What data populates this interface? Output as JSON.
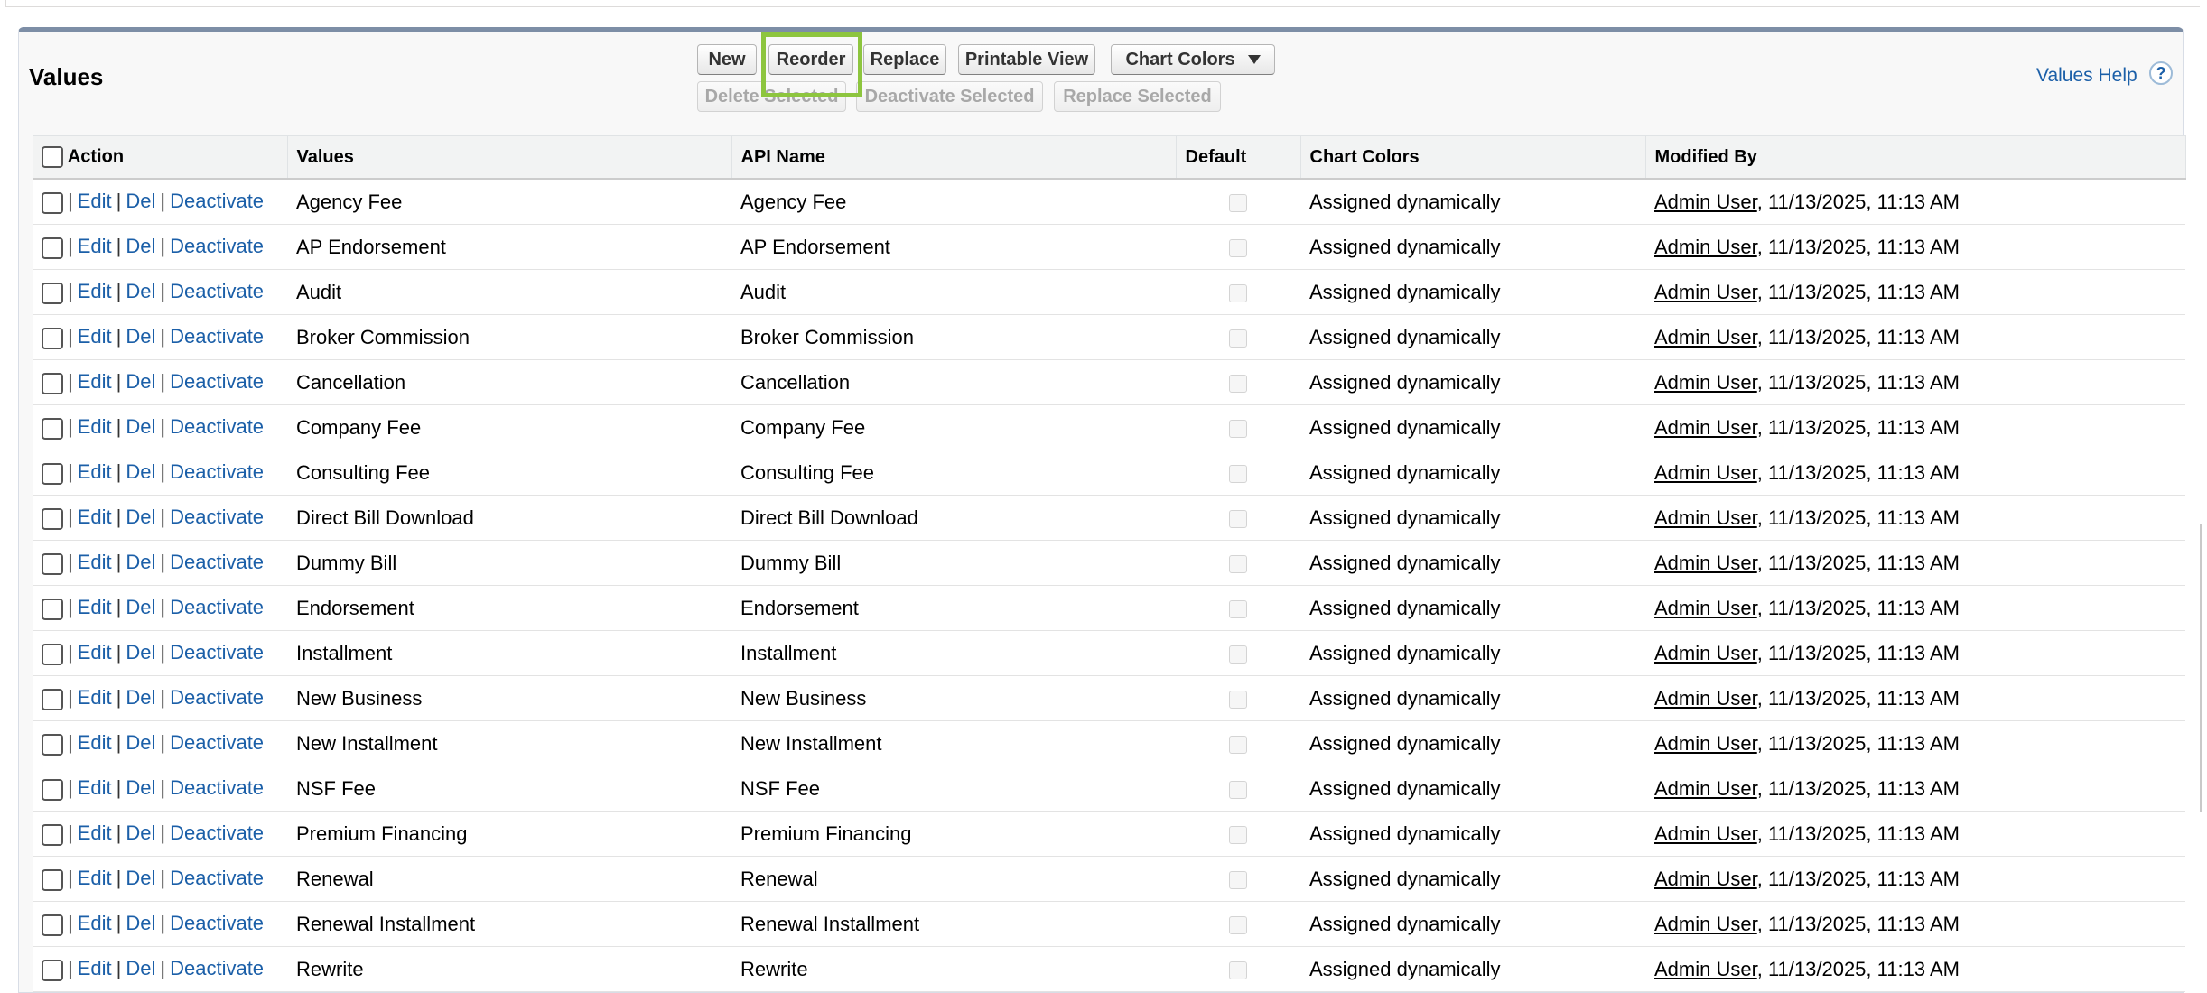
{
  "section": {
    "title": "Values",
    "help_label": "Values Help",
    "help_icon": "?"
  },
  "toolbar": {
    "new_label": "New",
    "reorder_label": "Reorder",
    "replace_label": "Replace",
    "printable_view_label": "Printable View",
    "chart_colors_label": "Chart Colors",
    "delete_selected_label": "Delete Selected",
    "deactivate_selected_label": "Deactivate Selected",
    "replace_selected_label": "Replace Selected"
  },
  "highlight_color": "#8dc53e",
  "table": {
    "headers": {
      "action": "Action",
      "values": "Values",
      "api_name": "API Name",
      "default": "Default",
      "chart_colors": "Chart Colors",
      "modified_by": "Modified By"
    },
    "action_labels": {
      "edit": "Edit",
      "del": "Del",
      "deactivate": "Deactivate",
      "separator": "|"
    },
    "rows": [
      {
        "value": "Agency Fee",
        "api_name": "Agency Fee",
        "chart_color": "Assigned dynamically",
        "user": "Admin User",
        "date": ", 11/13/2025, 11:13 AM"
      },
      {
        "value": "AP Endorsement",
        "api_name": "AP Endorsement",
        "chart_color": "Assigned dynamically",
        "user": "Admin User",
        "date": ", 11/13/2025, 11:13 AM"
      },
      {
        "value": "Audit",
        "api_name": "Audit",
        "chart_color": "Assigned dynamically",
        "user": "Admin User",
        "date": ", 11/13/2025, 11:13 AM"
      },
      {
        "value": "Broker Commission",
        "api_name": "Broker Commission",
        "chart_color": "Assigned dynamically",
        "user": "Admin User",
        "date": ", 11/13/2025, 11:13 AM"
      },
      {
        "value": "Cancellation",
        "api_name": "Cancellation",
        "chart_color": "Assigned dynamically",
        "user": "Admin User",
        "date": ", 11/13/2025, 11:13 AM"
      },
      {
        "value": "Company Fee",
        "api_name": "Company Fee",
        "chart_color": "Assigned dynamically",
        "user": "Admin User",
        "date": ", 11/13/2025, 11:13 AM"
      },
      {
        "value": "Consulting Fee",
        "api_name": "Consulting Fee",
        "chart_color": "Assigned dynamically",
        "user": "Admin User",
        "date": ", 11/13/2025, 11:13 AM"
      },
      {
        "value": "Direct Bill Download",
        "api_name": "Direct Bill Download",
        "chart_color": "Assigned dynamically",
        "user": "Admin User",
        "date": ", 11/13/2025, 11:13 AM"
      },
      {
        "value": "Dummy Bill",
        "api_name": "Dummy Bill",
        "chart_color": "Assigned dynamically",
        "user": "Admin User",
        "date": ", 11/13/2025, 11:13 AM"
      },
      {
        "value": "Endorsement",
        "api_name": "Endorsement",
        "chart_color": "Assigned dynamically",
        "user": "Admin User",
        "date": ", 11/13/2025, 11:13 AM"
      },
      {
        "value": "Installment",
        "api_name": "Installment",
        "chart_color": "Assigned dynamically",
        "user": "Admin User",
        "date": ", 11/13/2025, 11:13 AM"
      },
      {
        "value": "New Business",
        "api_name": "New Business",
        "chart_color": "Assigned dynamically",
        "user": "Admin User",
        "date": ", 11/13/2025, 11:13 AM"
      },
      {
        "value": "New Installment",
        "api_name": "New Installment",
        "chart_color": "Assigned dynamically",
        "user": "Admin User",
        "date": ", 11/13/2025, 11:13 AM"
      },
      {
        "value": "NSF Fee",
        "api_name": "NSF Fee",
        "chart_color": "Assigned dynamically",
        "user": "Admin User",
        "date": ", 11/13/2025, 11:13 AM"
      },
      {
        "value": "Premium Financing",
        "api_name": "Premium Financing",
        "chart_color": "Assigned dynamically",
        "user": "Admin User",
        "date": ", 11/13/2025, 11:13 AM"
      },
      {
        "value": "Renewal",
        "api_name": "Renewal",
        "chart_color": "Assigned dynamically",
        "user": "Admin User",
        "date": ", 11/13/2025, 11:13 AM"
      },
      {
        "value": "Renewal Installment",
        "api_name": "Renewal Installment",
        "chart_color": "Assigned dynamically",
        "user": "Admin User",
        "date": ", 11/13/2025, 11:13 AM"
      },
      {
        "value": "Rewrite",
        "api_name": "Rewrite",
        "chart_color": "Assigned dynamically",
        "user": "Admin User",
        "date": ", 11/13/2025, 11:13 AM"
      }
    ]
  }
}
